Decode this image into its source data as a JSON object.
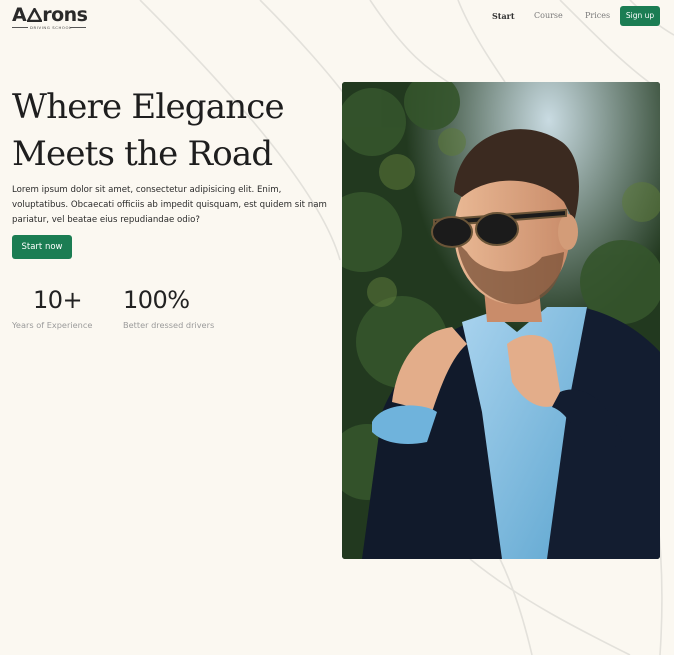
{
  "header": {
    "logo_text": "Arons",
    "logo_tagline": "DRIVING SCHOOL",
    "nav": [
      {
        "label": "Start",
        "active": true
      },
      {
        "label": "Course",
        "active": false
      },
      {
        "label": "Prices",
        "active": false
      }
    ],
    "signup_label": "Sign up"
  },
  "hero": {
    "title_line1": "Where Elegance",
    "title_line2": "Meets the Road",
    "description": "Lorem ipsum dolor sit amet, consectetur adipisicing elit. Enim, voluptatibus. Obcaecati officiis ab impedit quisquam, est quidem sit nam pariatur, vel beatae eius repudiandae odio?",
    "cta_label": "Start now"
  },
  "stats": [
    {
      "value": "10+",
      "label": "Years of Experience"
    },
    {
      "value": "100%",
      "label": "Better dressed drivers"
    }
  ],
  "colors": {
    "background": "#fbf8f1",
    "accent": "#1b7d53",
    "text": "#222222",
    "muted": "#9b9b9b"
  },
  "icons": {
    "logo_mark": "triangle-icon"
  }
}
